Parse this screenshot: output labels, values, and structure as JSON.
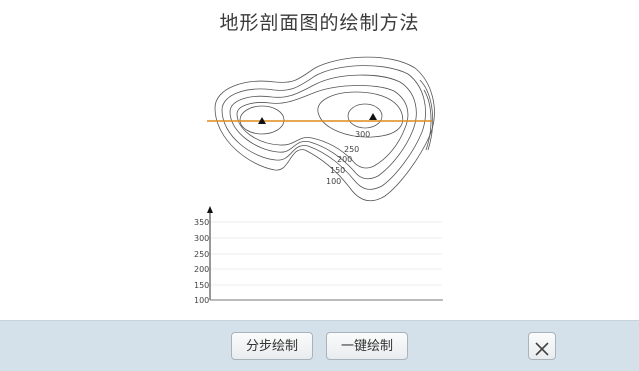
{
  "title": "地形剖面图的绘制方法",
  "contour_labels": [
    "300",
    "250",
    "200",
    "150",
    "100"
  ],
  "profile": {
    "y_ticks": [
      "350",
      "300",
      "250",
      "200",
      "150",
      "100"
    ]
  },
  "buttons": {
    "step_draw": "分步绘制",
    "one_click_draw": "一键绘制",
    "close_icon": "close-icon"
  },
  "colors": {
    "profile_line": "#e08a1a",
    "footer_bg": "#d5e1ea"
  }
}
